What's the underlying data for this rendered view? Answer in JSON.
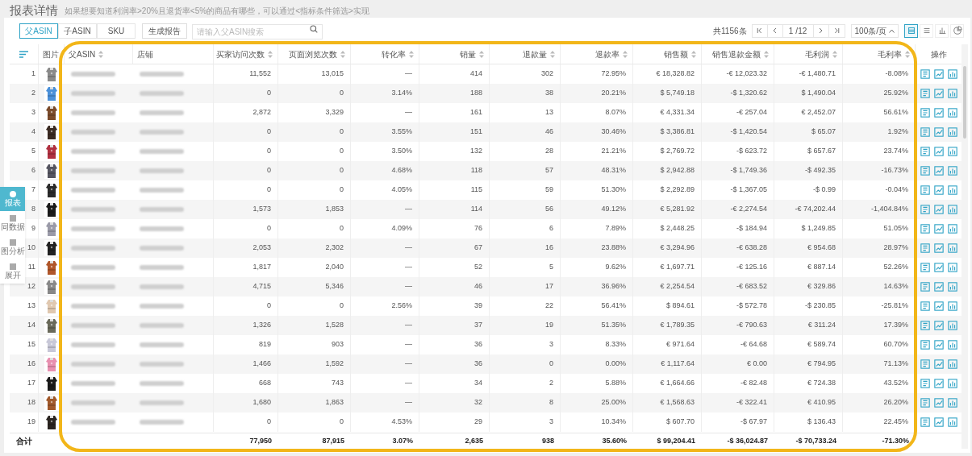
{
  "page": {
    "title": "报表详情",
    "hint": "如果想要知道利润率>20%且退货率<5%的商品有哪些，可以通过<指标条件筛选>实现"
  },
  "toolbar": {
    "tabs": [
      {
        "label": "父ASIN",
        "selected": true
      },
      {
        "label": "子ASIN",
        "selected": false
      },
      {
        "label": "SKU",
        "selected": false
      }
    ],
    "generate_button": "生成报告",
    "search": {
      "placeholder": "请输入父ASIN搜索"
    }
  },
  "pagination": {
    "total": "共1156条",
    "page": "1",
    "pages": "/12",
    "page_size": "100条/页"
  },
  "view_buttons": [
    {
      "kind": "table",
      "selected": true
    },
    {
      "kind": "list",
      "selected": false
    },
    {
      "kind": "bar",
      "selected": false
    },
    {
      "kind": "pie",
      "selected": false
    }
  ],
  "side_panel": [
    {
      "label": "报表",
      "selected": true
    },
    {
      "label": "同数据",
      "selected": false
    },
    {
      "label": "图分析",
      "selected": false
    },
    {
      "label": "展开",
      "selected": false
    }
  ],
  "table": {
    "columns": [
      {
        "label": "图片",
        "sortable": false
      },
      {
        "label": "父ASIN",
        "sortable": true
      },
      {
        "label": "店铺",
        "sortable": false
      },
      {
        "label": "买家访问次数",
        "sortable": true
      },
      {
        "label": "页面浏览次数",
        "sortable": true
      },
      {
        "label": "转化率",
        "sortable": true
      },
      {
        "label": "销量",
        "sortable": true
      },
      {
        "label": "退款量",
        "sortable": true
      },
      {
        "label": "退款率",
        "sortable": true
      },
      {
        "label": "销售额",
        "sortable": true
      },
      {
        "label": "销售退款金额",
        "sortable": true
      },
      {
        "label": "毛利润",
        "sortable": true
      },
      {
        "label": "毛利率",
        "sortable": true
      },
      {
        "label": "操作",
        "sortable": false
      }
    ],
    "rows": [
      {
        "index": "1",
        "values": [
          "11,552",
          "13,015",
          "—",
          "414",
          "302",
          "72.95%",
          "€ 18,328.82",
          "-€ 12,023.32",
          "-€ 1,480.71",
          "-8.08%"
        ]
      },
      {
        "index": "2",
        "values": [
          "0",
          "0",
          "3.14%",
          "188",
          "38",
          "20.21%",
          "$ 5,749.18",
          "-$ 1,320.62",
          "$ 1,490.04",
          "25.92%"
        ]
      },
      {
        "index": "3",
        "values": [
          "2,872",
          "3,329",
          "—",
          "161",
          "13",
          "8.07%",
          "€ 4,331.34",
          "-€ 257.04",
          "€ 2,452.07",
          "56.61%"
        ]
      },
      {
        "index": "4",
        "values": [
          "0",
          "0",
          "3.55%",
          "151",
          "46",
          "30.46%",
          "$ 3,386.81",
          "-$ 1,420.54",
          "$ 65.07",
          "1.92%"
        ]
      },
      {
        "index": "5",
        "values": [
          "0",
          "0",
          "3.50%",
          "132",
          "28",
          "21.21%",
          "$ 2,769.72",
          "-$ 623.72",
          "$ 657.67",
          "23.74%"
        ]
      },
      {
        "index": "6",
        "values": [
          "0",
          "0",
          "4.68%",
          "118",
          "57",
          "48.31%",
          "$ 2,942.88",
          "-$ 1,749.36",
          "-$ 492.35",
          "-16.73%"
        ]
      },
      {
        "index": "7",
        "values": [
          "0",
          "0",
          "4.05%",
          "115",
          "59",
          "51.30%",
          "$ 2,292.89",
          "-$ 1,367.05",
          "-$ 0.99",
          "-0.04%"
        ]
      },
      {
        "index": "8",
        "values": [
          "1,573",
          "1,853",
          "—",
          "114",
          "56",
          "49.12%",
          "€ 5,281.92",
          "-€ 2,274.54",
          "-€ 74,202.44",
          "-1,404.84%"
        ]
      },
      {
        "index": "9",
        "values": [
          "0",
          "0",
          "4.09%",
          "76",
          "6",
          "7.89%",
          "$ 2,448.25",
          "-$ 184.94",
          "$ 1,249.85",
          "51.05%"
        ]
      },
      {
        "index": "10",
        "values": [
          "2,053",
          "2,302",
          "—",
          "67",
          "16",
          "23.88%",
          "€ 3,294.96",
          "-€ 638.28",
          "€ 954.68",
          "28.97%"
        ]
      },
      {
        "index": "11",
        "values": [
          "1,817",
          "2,040",
          "—",
          "52",
          "5",
          "9.62%",
          "€ 1,697.71",
          "-€ 125.16",
          "€ 887.14",
          "52.26%"
        ]
      },
      {
        "index": "12",
        "values": [
          "4,715",
          "5,346",
          "—",
          "46",
          "17",
          "36.96%",
          "€ 2,254.54",
          "-€ 683.52",
          "€ 329.86",
          "14.63%"
        ]
      },
      {
        "index": "13",
        "values": [
          "0",
          "0",
          "2.56%",
          "39",
          "22",
          "56.41%",
          "$ 894.61",
          "-$ 572.78",
          "-$ 230.85",
          "-25.81%"
        ]
      },
      {
        "index": "14",
        "values": [
          "1,326",
          "1,528",
          "—",
          "37",
          "19",
          "51.35%",
          "€ 1,789.35",
          "-€ 790.63",
          "€ 311.24",
          "17.39%"
        ]
      },
      {
        "index": "15",
        "values": [
          "819",
          "903",
          "—",
          "36",
          "3",
          "8.33%",
          "€ 971.64",
          "-€ 64.68",
          "€ 589.74",
          "60.70%"
        ]
      },
      {
        "index": "16",
        "values": [
          "1,466",
          "1,592",
          "—",
          "36",
          "0",
          "0.00%",
          "€ 1,117.64",
          "€ 0.00",
          "€ 794.95",
          "71.13%"
        ]
      },
      {
        "index": "17",
        "values": [
          "668",
          "743",
          "—",
          "34",
          "2",
          "5.88%",
          "€ 1,664.66",
          "-€ 82.48",
          "€ 724.38",
          "43.52%"
        ]
      },
      {
        "index": "18",
        "values": [
          "1,680",
          "1,863",
          "—",
          "32",
          "8",
          "25.00%",
          "€ 1,568.63",
          "-€ 322.41",
          "€ 410.95",
          "26.20%"
        ]
      },
      {
        "index": "19",
        "values": [
          "0",
          "0",
          "4.53%",
          "29",
          "3",
          "10.34%",
          "$ 607.70",
          "-$ 67.97",
          "$ 136.43",
          "22.45%"
        ]
      }
    ],
    "footer": {
      "label": "合计",
      "values": [
        "77,950",
        "87,915",
        "3.07%",
        "2,635",
        "938",
        "35.60%",
        "$ 99,204.41",
        "-$ 36,024.87",
        "-$ 70,733.24",
        "-71.30%"
      ]
    }
  }
}
